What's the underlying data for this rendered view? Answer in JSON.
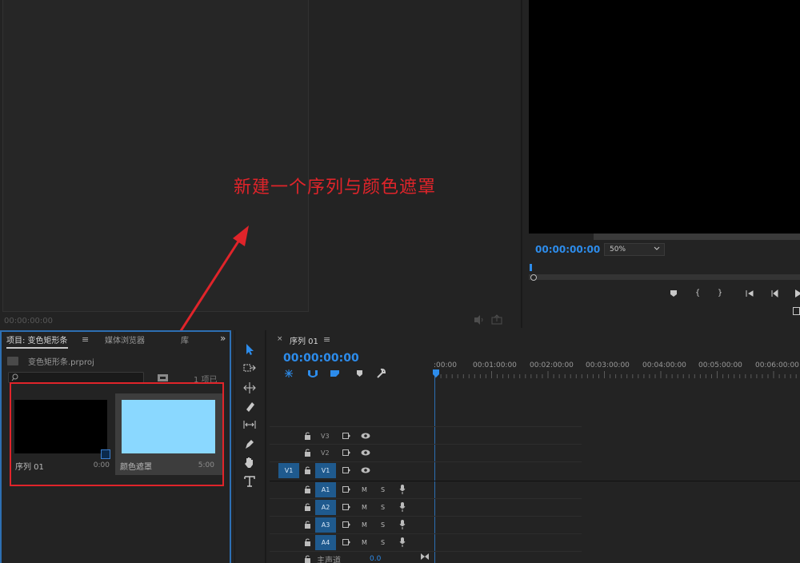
{
  "source_monitor": {
    "timecode": "00:00:00:00"
  },
  "program_monitor": {
    "timecode": "00:00:00:00",
    "zoom": "50%",
    "controls": [
      "add-marker",
      "mark-in",
      "mark-out",
      "go-to-in",
      "step-back",
      "play"
    ]
  },
  "annotation": {
    "text": "新建一个序列与颜色遮罩",
    "color": "#e0242a"
  },
  "project_panel": {
    "tabs": [
      {
        "label": "项目: 变色矩形条",
        "active": true
      },
      {
        "label": "媒体浏览器",
        "active": false
      },
      {
        "label": "库",
        "active": false
      }
    ],
    "menu_glyph": "≡",
    "expand_glyph": "»",
    "filename": "变色矩形条.prproj",
    "search_value": "",
    "item_count": "1 项已",
    "items": [
      {
        "name": "序列 01",
        "duration": "0:00",
        "thumb_color": "#000000"
      },
      {
        "name": "颜色遮罩",
        "duration": "5:00",
        "thumb_color": "#8ad8ff"
      }
    ]
  },
  "tools": [
    "selection-tool",
    "track-select-tool",
    "ripple-edit-tool",
    "razor-tool",
    "slip-tool",
    "pen-tool",
    "hand-tool",
    "type-tool"
  ],
  "timeline": {
    "close_glyph": "×",
    "tab_label": "序列 01",
    "menu_glyph": "≡",
    "timecode": "00:00:00:00",
    "ruler_labels": [
      ":00:00",
      "00:01:00:00",
      "00:02:00:00",
      "00:03:00:00",
      "00:04:00:00",
      "00:05:00:00",
      "00:06:00:00"
    ],
    "video_tracks": [
      {
        "name": "V3",
        "targeted": false,
        "source_patch": ""
      },
      {
        "name": "V2",
        "targeted": false,
        "source_patch": ""
      },
      {
        "name": "V1",
        "targeted": true,
        "source_patch": "V1"
      }
    ],
    "audio_tracks": [
      {
        "name": "A1",
        "mute": "M",
        "solo": "S"
      },
      {
        "name": "A2",
        "mute": "M",
        "solo": "S"
      },
      {
        "name": "A3",
        "mute": "M",
        "solo": "S"
      },
      {
        "name": "A4",
        "mute": "M",
        "solo": "S"
      }
    ],
    "master": {
      "label": "主声道",
      "value": "0.0"
    }
  }
}
